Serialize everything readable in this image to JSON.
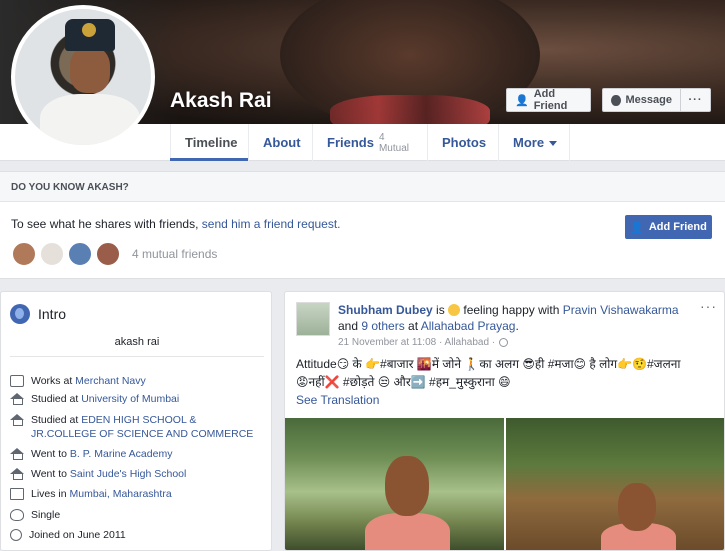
{
  "profile": {
    "name": "Akash Rai",
    "buttons": {
      "add_friend": "Add Friend",
      "message": "Message",
      "more": "···"
    }
  },
  "tabs": [
    {
      "label": "Timeline",
      "active": true
    },
    {
      "label": "About"
    },
    {
      "label": "Friends",
      "sub": "4 Mutual"
    },
    {
      "label": "Photos"
    },
    {
      "label": "More"
    }
  ],
  "dyk": {
    "heading": "DO YOU KNOW AKASH?",
    "text": "To see what he shares with friends, ",
    "link": "send him a friend request.",
    "button": "Add Friend",
    "mutual": "4 mutual friends"
  },
  "intro": {
    "title": "Intro",
    "bio": "akash rai",
    "rows": [
      {
        "icon": "briefcase-icon",
        "prefix": "Works at ",
        "link": "Merchant Navy",
        "suffix": ""
      },
      {
        "icon": "graduation-cap-icon",
        "prefix": "Studied at ",
        "link": "University of Mumbai",
        "suffix": ""
      },
      {
        "icon": "graduation-cap-icon",
        "prefix": "Studied at ",
        "link": "EDEN HIGH SCHOOL &",
        "suffix": "",
        "line2": "JR.COLLEGE OF SCIENCE AND COMMERCE"
      },
      {
        "icon": "graduation-cap-icon",
        "prefix": "Went to ",
        "link": "B. P. Marine Academy",
        "suffix": ""
      },
      {
        "icon": "graduation-cap-icon",
        "prefix": "Went to ",
        "link": "Saint Jude's High School",
        "suffix": ""
      },
      {
        "icon": "home-icon",
        "prefix": "Lives in ",
        "link": "Mumbai, Maharashtra",
        "suffix": ""
      },
      {
        "icon": "heart-icon",
        "prefix": "Single",
        "link": "",
        "suffix": ""
      },
      {
        "icon": "clock-icon",
        "prefix": "Joined on June 2011",
        "link": "",
        "suffix": ""
      }
    ]
  },
  "post": {
    "author": "Shubham Dubey",
    "is": " is ",
    "feeling": " feeling happy with ",
    "with": "Pravin Vishawakarma",
    "and": " and ",
    "others": "9 others",
    "at": " at ",
    "place": "Allahabad Prayag",
    "dot": ".",
    "date": "21 November at 11:08 · Allahabad ·",
    "more": "···",
    "text_line1": "Attitude😏 के 👉#बाजार 🌇में जोने 🚶का अलग 😎ही #मजा😊 है लोग👉🤨#जलना",
    "text_line2": "😡नहीं❌ #छोड़ते 😒 और➡️ #हम_मुस्कुराना 😄",
    "see_translation": "See Translation"
  }
}
